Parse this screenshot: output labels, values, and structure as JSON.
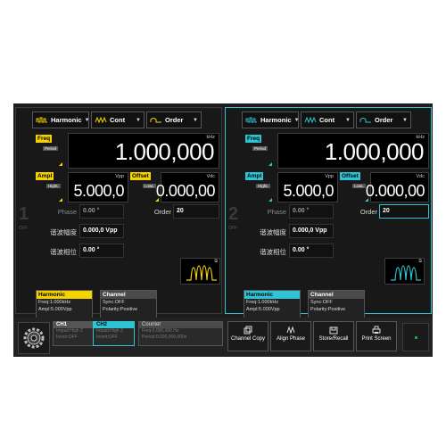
{
  "ch1": {
    "number": "1",
    "state": "OFF",
    "waveform": "Harmonic",
    "mode": "Cont",
    "order_menu": "Order",
    "freq": {
      "tag": "Freq",
      "sub": "Period",
      "value": "1.000,000",
      "unit": "kHz"
    },
    "ampl": {
      "tag": "Ampl",
      "sub": "HighL",
      "value": "5.000,0",
      "unit": "Vpp"
    },
    "offset": {
      "tag": "Offset",
      "sub": "LowL",
      "value": "0.000,00",
      "unit": "Vdc"
    },
    "phase": {
      "label": "Phase",
      "value": "0.00 °"
    },
    "order": {
      "label": "Order",
      "value": "20"
    },
    "harm_ampl": {
      "label": "谐波幅度",
      "value": "0.000,0 Vpp"
    },
    "harm_phase": {
      "label": "谐波相位",
      "value": "0.00 °"
    },
    "card_harmonic": {
      "title": "Harmonic",
      "lines": [
        "Freq:1.000kHz",
        "Ampl:5.000Vpp"
      ]
    },
    "card_channel": {
      "title": "Channel",
      "lines": [
        "Sync:OFF",
        "Polarity:Positive"
      ]
    }
  },
  "ch2": {
    "number": "2",
    "state": "OFF",
    "waveform": "Harmonic",
    "mode": "Cont",
    "order_menu": "Order",
    "freq": {
      "tag": "Freq",
      "sub": "Period",
      "value": "1.000,000",
      "unit": "kHz"
    },
    "ampl": {
      "tag": "Ampl",
      "sub": "HighL",
      "value": "5.000,0",
      "unit": "Vpp"
    },
    "offset": {
      "tag": "Offset",
      "sub": "LowL",
      "value": "0.000,00",
      "unit": "Vdc"
    },
    "phase": {
      "label": "Phase",
      "value": "0.00 °"
    },
    "order": {
      "label": "Order",
      "value": "20"
    },
    "harm_ampl": {
      "label": "谐波幅度",
      "value": "0.000,0 Vpp"
    },
    "harm_phase": {
      "label": "谐波相位",
      "value": "0.00 °"
    },
    "card_harmonic": {
      "title": "Harmonic",
      "lines": [
        "Freq:1.000kHz",
        "Ampl:5.000Vpp"
      ]
    },
    "card_channel": {
      "title": "Channel",
      "lines": [
        "Sync:OFF",
        "Polarity:Positive"
      ]
    }
  },
  "bottom": {
    "ch1": {
      "title": "CH1",
      "lines": [
        "Impad:High Z",
        "Invert:OFF"
      ]
    },
    "ch2": {
      "title": "CH2",
      "lines": [
        "Impad:High Z",
        "Invert:OFF"
      ]
    },
    "counter": {
      "title": "Counter",
      "lines": [
        "Freq:0.000,000 Hz",
        "Period:0.000,000,000s"
      ]
    },
    "buttons": [
      "Channel Copy",
      "Align Phase",
      "Store/Recall",
      "Print Screen"
    ]
  },
  "colors": {
    "ch1_accent": "#f5d300",
    "ch2_accent": "#2ec4d6",
    "led": "#1aa84a"
  },
  "icons": [
    "settings-gear-icon",
    "harmonic-wave-icon",
    "cont-wave-icon",
    "order-wave-icon",
    "chevron-down-icon",
    "copy-icon",
    "align-icon",
    "store-icon",
    "print-icon",
    "expand-icon"
  ]
}
